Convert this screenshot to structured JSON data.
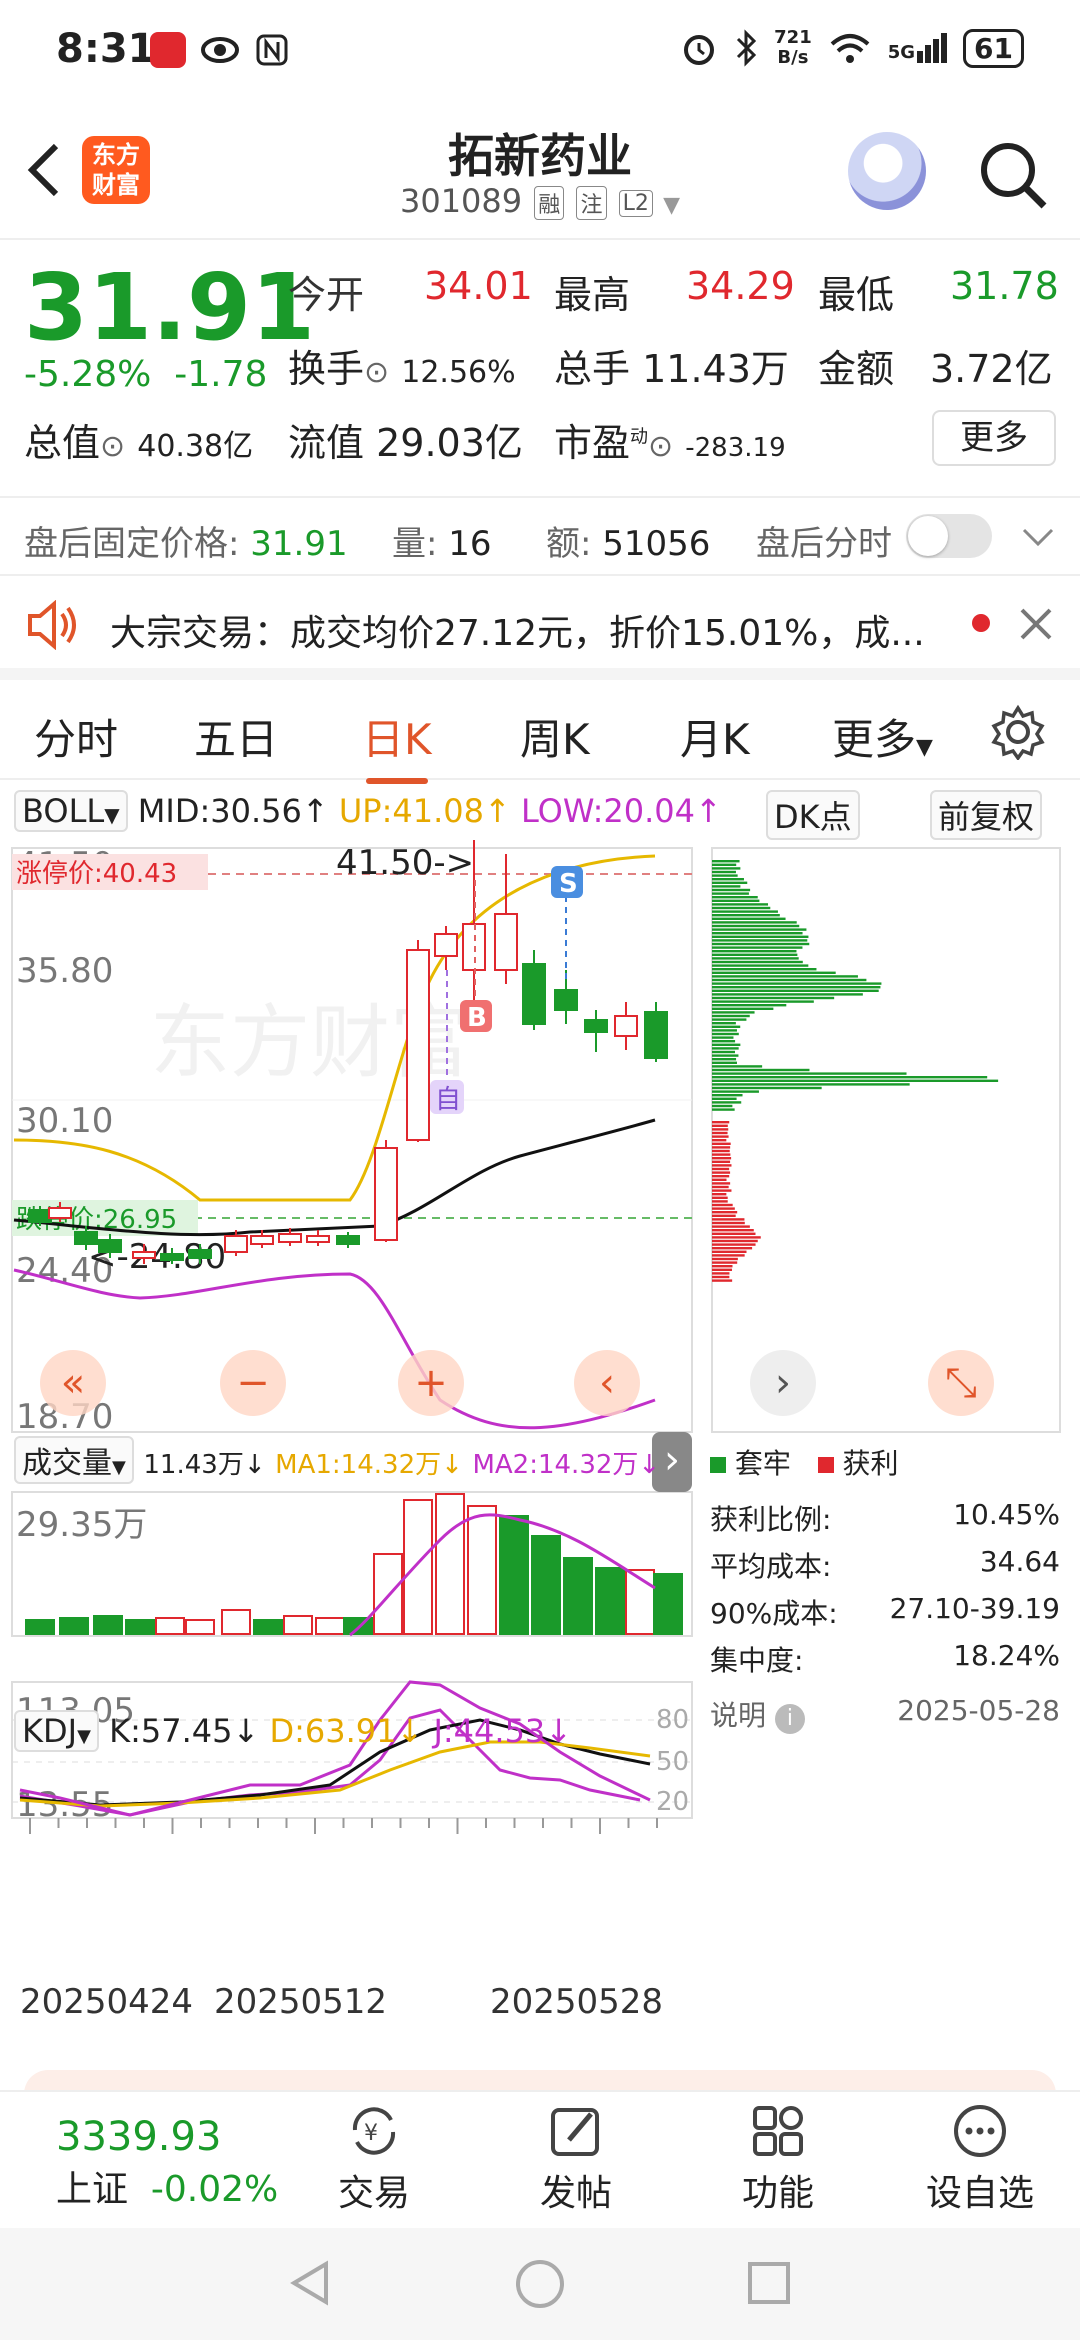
{
  "status": {
    "time": "8:31",
    "net_speed_top": "721",
    "net_speed_bottom": "B/s",
    "signal": "5G",
    "battery": "61"
  },
  "header": {
    "logo_line1": "东方",
    "logo_line2": "财富",
    "title": "拓新药业",
    "code": "301089",
    "tag1": "融",
    "tag2": "注",
    "tag3": "L2"
  },
  "quote": {
    "price": "31.91",
    "change_pct": "-5.28%",
    "change": "-1.78",
    "open_label": "今开",
    "open": "34.01",
    "high_label": "最高",
    "high": "34.29",
    "low_label": "最低",
    "low": "31.78",
    "turnover_label": "换手",
    "turnover": "12.56%",
    "volume_label": "总手",
    "volume": "11.43万",
    "amount_label": "金额",
    "amount": "3.72亿",
    "mktcap_label": "总值",
    "mktcap": "40.38亿",
    "float_label": "流值",
    "float": "29.03亿",
    "pe_label": "市盈",
    "pe_sup": "动",
    "pe": "-283.19",
    "more": "更多"
  },
  "afterhours": {
    "price_label": "盘后固定价格:",
    "price": "31.91",
    "vol_label": "量:",
    "vol": "16",
    "amt_label": "额:",
    "amt": "51056",
    "toggle_label": "盘后分时"
  },
  "notice": {
    "text": "大宗交易：成交均价27.12元，折价15.01%，成..."
  },
  "tabs": [
    "分时",
    "五日",
    "日K",
    "周K",
    "月K",
    "更多"
  ],
  "boll": {
    "name": "BOLL",
    "mid": "MID:30.56↑",
    "up": "UP:41.08↑",
    "low": "LOW:20.04↑",
    "dk": "DK点",
    "adjust": "前复权"
  },
  "kline": {
    "axis": [
      "41.50",
      "35.80",
      "30.10",
      "24.40",
      "18.70"
    ],
    "limit_up": "涨停价:40.43",
    "limit_down": "跌停价:26.95",
    "max_label": "41.50->",
    "min_label": "<-24.80",
    "b_label": "B",
    "s_label": "S",
    "self_label": "自",
    "watermark": "东方财富"
  },
  "volume": {
    "name": "成交量",
    "value": "11.43万↓",
    "ma1": "MA1:14.32万↓",
    "ma2": "MA2:14.32万↓",
    "axis_max": "29.35万"
  },
  "kdj": {
    "name": "KDJ",
    "k": "K:57.45↓",
    "d": "D:63.91↓",
    "j": "J:44.53↓",
    "axis_max": "113.05",
    "axis_min": "13.55",
    "lv80": "80",
    "lv50": "50",
    "lv20": "20"
  },
  "dates": [
    "20250424",
    "20250512",
    "20250528"
  ],
  "chip": {
    "legend_trapped": "套牢",
    "legend_profit": "获利",
    "rows": [
      {
        "label": "获利比例:",
        "value": "10.45%"
      },
      {
        "label": "平均成本:",
        "value": "34.64"
      },
      {
        "label": "90%成本:",
        "value": "27.10-39.19"
      },
      {
        "label": "集中度:",
        "value": "18.24%"
      }
    ],
    "note": "说明",
    "date": "2025-05-28"
  },
  "bottom": {
    "index_value": "3339.93",
    "index_name": "上证",
    "index_change": "-0.02%",
    "items": [
      "交易",
      "发帖",
      "功能",
      "设自选"
    ]
  },
  "colors": {
    "up": "#e0282e",
    "down": "#1a9a2a",
    "accent": "#e0552a",
    "boll_up": "#e6b800",
    "boll_low": "#c030c8"
  }
}
